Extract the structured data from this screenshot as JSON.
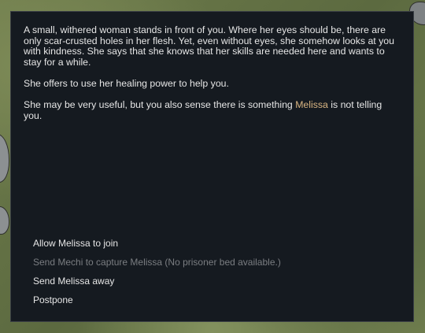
{
  "dialog": {
    "paragraph1": "A small, withered woman stands in front of you. Where her eyes should be, there are only scar-crusted holes in her flesh. Yet, even without eyes, she somehow looks at you with kindness. She says that she knows that her skills are needed here and wants to stay for a while.",
    "paragraph2": "She offers to use her healing power to help you.",
    "paragraph3_before": "She may be very useful, but you also sense there is something ",
    "paragraph3_name": "Melissa",
    "paragraph3_after": " is not telling you.",
    "options": [
      {
        "label": "Allow Melissa to join",
        "enabled": true
      },
      {
        "label": "Send Mechi to capture Melissa (No prisoner bed available.)",
        "enabled": false
      },
      {
        "label": "Send Melissa away",
        "enabled": true
      },
      {
        "label": "Postpone",
        "enabled": true
      }
    ]
  },
  "colors": {
    "dialog_bg": "#151a20",
    "text": "#e6e6e6",
    "name_highlight": "#d9b582",
    "disabled_text": "#7a7d81"
  }
}
